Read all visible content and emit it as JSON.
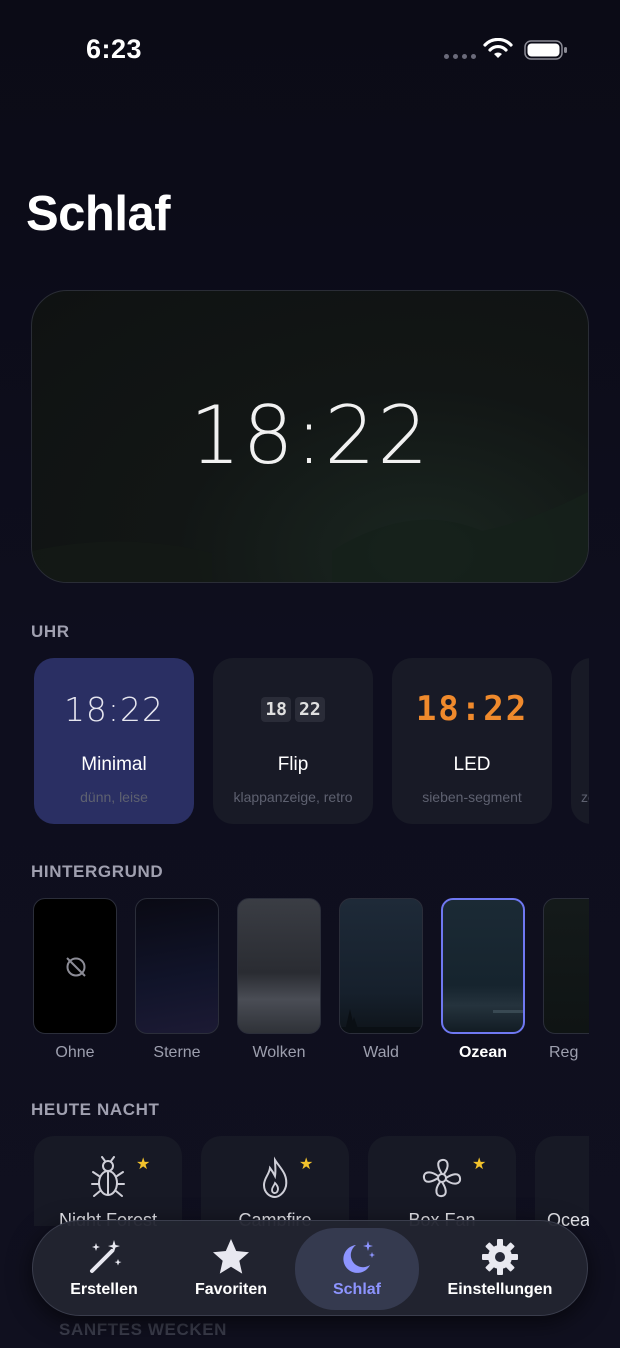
{
  "status_bar": {
    "time": "6:23"
  },
  "page": {
    "title": "Schlaf"
  },
  "preview": {
    "time": "18:22"
  },
  "clock_section": {
    "label": "UHR",
    "styles": [
      {
        "name": "Minimal",
        "desc": "dünn, leise",
        "sample": "18:22",
        "selected": true
      },
      {
        "name": "Flip",
        "desc": "klappanzeige, retro",
        "sample_hours": "18",
        "sample_minutes": "22"
      },
      {
        "name": "LED",
        "desc": "sieben-segment",
        "sample": "18:22"
      },
      {
        "name": "",
        "desc": "ze"
      }
    ]
  },
  "background_section": {
    "label": "HINTERGRUND",
    "items": [
      {
        "name": "Ohne",
        "icon": "no-image-icon"
      },
      {
        "name": "Sterne"
      },
      {
        "name": "Wolken"
      },
      {
        "name": "Wald"
      },
      {
        "name": "Ozean",
        "selected": true
      },
      {
        "name": "Reg"
      }
    ]
  },
  "tonight_section": {
    "label": "HEUTE NACHT",
    "items": [
      {
        "name": "Night Forest",
        "icon": "bug-icon",
        "favorite": true
      },
      {
        "name": "Campfire",
        "icon": "flame-icon",
        "favorite": true
      },
      {
        "name": "Box Fan",
        "icon": "fan-icon",
        "favorite": true
      },
      {
        "name": "Ocea",
        "icon": "wave-icon"
      }
    ]
  },
  "next_section_label": "SANFTES WECKEN",
  "tabbar": {
    "tabs": [
      {
        "label": "Erstellen",
        "icon": "magic-wand-icon"
      },
      {
        "label": "Favoriten",
        "icon": "star-icon"
      },
      {
        "label": "Schlaf",
        "icon": "moon-stars-icon",
        "active": true
      },
      {
        "label": "Einstellungen",
        "icon": "gear-icon"
      }
    ],
    "active_color": "#8d94ff"
  },
  "colors": {
    "background": "#0c0c18",
    "selected_card": "#2a2f63",
    "led": "#f08a2c",
    "favorite_star": "#f2c22c",
    "selected_border": "#6f78f2"
  }
}
